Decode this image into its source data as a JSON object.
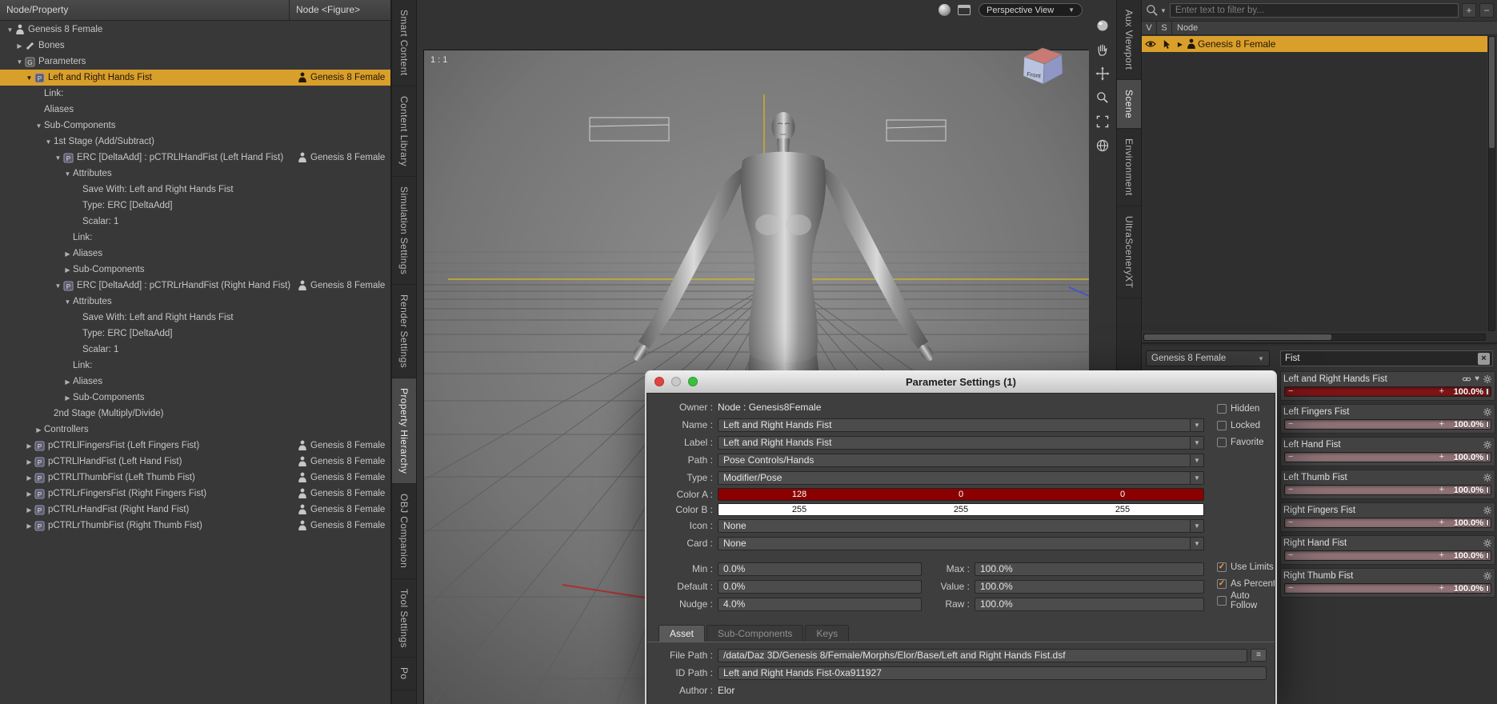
{
  "ui_colors": {
    "selection_highlight": "#d99f2b",
    "dialog_color_a_bg": "#8b0000",
    "dialog_color_a_fg": "#ffffff",
    "dialog_color_b_bg": "#ffffff",
    "dialog_color_b_fg": "#111111",
    "slider_fill_selected": "#7d1416",
    "slider_fill_default": "#8d7175"
  },
  "left_panel": {
    "header": {
      "label": "Node/Property",
      "column_label": "Node <Figure>"
    },
    "tree": [
      {
        "indent": 0,
        "arrow": "down",
        "icon": "figure",
        "label": "Genesis 8 Female"
      },
      {
        "indent": 1,
        "arrow": "right",
        "icon": "bone",
        "label": "Bones"
      },
      {
        "indent": 1,
        "arrow": "down",
        "icon": "group",
        "label": "Parameters"
      },
      {
        "indent": 2,
        "arrow": "down",
        "icon": "param",
        "label": "Left and Right Hands Fist",
        "right": "Genesis 8 Female",
        "selected": true
      },
      {
        "indent": 3,
        "label": "Link:"
      },
      {
        "indent": 3,
        "label": "Aliases"
      },
      {
        "indent": 3,
        "arrow": "down",
        "label": "Sub-Components"
      },
      {
        "indent": 4,
        "arrow": "down",
        "label": "1st Stage (Add/Subtract)"
      },
      {
        "indent": 5,
        "arrow": "down",
        "icon": "param",
        "label": "ERC [DeltaAdd] : pCTRLlHandFist (Left Hand Fist)",
        "right": "Genesis 8 Female"
      },
      {
        "indent": 6,
        "arrow": "down",
        "label": "Attributes"
      },
      {
        "indent": 7,
        "label": "Save With: Left and Right Hands Fist"
      },
      {
        "indent": 7,
        "label": "Type: ERC [DeltaAdd]"
      },
      {
        "indent": 7,
        "label": "Scalar: 1"
      },
      {
        "indent": 6,
        "label": "Link:"
      },
      {
        "indent": 6,
        "arrow": "right",
        "label": "Aliases"
      },
      {
        "indent": 6,
        "arrow": "right",
        "label": "Sub-Components"
      },
      {
        "indent": 5,
        "arrow": "down",
        "icon": "param",
        "label": "ERC [DeltaAdd] : pCTRLrHandFist (Right Hand Fist)",
        "right": "Genesis 8 Female"
      },
      {
        "indent": 6,
        "arrow": "down",
        "label": "Attributes"
      },
      {
        "indent": 7,
        "label": "Save With: Left and Right Hands Fist"
      },
      {
        "indent": 7,
        "label": "Type: ERC [DeltaAdd]"
      },
      {
        "indent": 7,
        "label": "Scalar: 1"
      },
      {
        "indent": 6,
        "label": "Link:"
      },
      {
        "indent": 6,
        "arrow": "right",
        "label": "Aliases"
      },
      {
        "indent": 6,
        "arrow": "right",
        "label": "Sub-Components"
      },
      {
        "indent": 4,
        "label": "2nd Stage (Multiply/Divide)"
      },
      {
        "indent": 3,
        "arrow": "right",
        "label": "Controllers"
      },
      {
        "indent": 2,
        "arrow": "right",
        "icon": "param",
        "label": "pCTRLlFingersFist (Left Fingers Fist)",
        "right": "Genesis 8 Female"
      },
      {
        "indent": 2,
        "arrow": "right",
        "icon": "param",
        "label": "pCTRLlHandFist (Left Hand Fist)",
        "right": "Genesis 8 Female"
      },
      {
        "indent": 2,
        "arrow": "right",
        "icon": "param",
        "label": "pCTRLlThumbFist (Left Thumb Fist)",
        "right": "Genesis 8 Female"
      },
      {
        "indent": 2,
        "arrow": "right",
        "icon": "param",
        "label": "pCTRLrFingersFist (Right Fingers Fist)",
        "right": "Genesis 8 Female"
      },
      {
        "indent": 2,
        "arrow": "right",
        "icon": "param",
        "label": "pCTRLrHandFist (Right Hand Fist)",
        "right": "Genesis 8 Female"
      },
      {
        "indent": 2,
        "arrow": "right",
        "icon": "param",
        "label": "pCTRLrThumbFist (Right Thumb Fist)",
        "right": "Genesis 8 Female"
      }
    ]
  },
  "left_tabs": {
    "items": [
      {
        "label": "Smart Content"
      },
      {
        "label": "Content Library"
      },
      {
        "label": "Simulation Settings"
      },
      {
        "label": "Render Settings"
      },
      {
        "label": "Property Hierarchy",
        "active": true
      },
      {
        "label": "OBJ Companion"
      },
      {
        "label": "Tool Settings"
      },
      {
        "label": "Po"
      }
    ]
  },
  "right_tabs": {
    "items": [
      {
        "label": "Aux Viewport"
      },
      {
        "label": "Scene",
        "active": true
      },
      {
        "label": "Environment"
      },
      {
        "label": "UltraSceneryXT"
      }
    ]
  },
  "viewport": {
    "aspect_label": "1 : 1",
    "camera_selector_label": "Perspective View",
    "cube_face_label": "Front",
    "tool_icons": [
      "sphere",
      "hand",
      "pan",
      "zoom",
      "frame",
      "globe"
    ]
  },
  "scene_panel": {
    "filter_placeholder": "Enter text to filter by...",
    "columns": {
      "visibility": "V",
      "selection": "S",
      "node": "Node"
    },
    "rows": [
      {
        "label": "Genesis 8 Female",
        "selected": true
      }
    ]
  },
  "parameters_panel": {
    "figure_selector": "Genesis 8 Female",
    "search_value": "Fist",
    "sliders": [
      {
        "label": "Left and Right Hands Fist",
        "value": "100.0%",
        "selected": true
      },
      {
        "label": "Left Fingers Fist",
        "value": "100.0%"
      },
      {
        "label": "Left Hand Fist",
        "value": "100.0%"
      },
      {
        "label": "Left Thumb Fist",
        "value": "100.0%"
      },
      {
        "label": "Right Fingers Fist",
        "value": "100.0%"
      },
      {
        "label": "Right Hand Fist",
        "value": "100.0%"
      },
      {
        "label": "Right Thumb Fist",
        "value": "100.0%"
      }
    ]
  },
  "dialog": {
    "title": "Parameter Settings (1)",
    "owner": {
      "label": "Owner :",
      "value": "Node : Genesis8Female"
    },
    "fields": [
      {
        "label": "Name :",
        "value": "Left and Right Hands Fist"
      },
      {
        "label": "Label :",
        "value": "Left and Right Hands Fist"
      },
      {
        "label": "Path :",
        "value": "Pose Controls/Hands"
      },
      {
        "label": "Type :",
        "value": "Modifier/Pose"
      }
    ],
    "color_a": {
      "label": "Color A :",
      "values": [
        "128",
        "0",
        "0"
      ]
    },
    "color_b": {
      "label": "Color B :",
      "values": [
        "255",
        "255",
        "255"
      ]
    },
    "icon_field": {
      "label": "Icon :",
      "value": "None"
    },
    "card_field": {
      "label": "Card :",
      "value": "None"
    },
    "limits": [
      {
        "label": "Min :",
        "value": "0.0%",
        "label2": "Max :",
        "value2": "100.0%"
      },
      {
        "label": "Default :",
        "value": "0.0%",
        "label2": "Value :",
        "value2": "100.0%"
      },
      {
        "label": "Nudge :",
        "value": "4.0%",
        "label2": "Raw :",
        "value2": "100.0%"
      }
    ],
    "flags_top": [
      {
        "label": "Hidden",
        "checked": false
      },
      {
        "label": "Locked",
        "checked": false
      },
      {
        "label": "Favorite",
        "checked": false
      }
    ],
    "flags_bottom": [
      {
        "label": "Use Limits",
        "checked": true
      },
      {
        "label": "As Percent",
        "checked": true
      },
      {
        "label": "Auto Follow",
        "checked": false
      }
    ],
    "tabs": [
      {
        "label": "Asset",
        "active": true
      },
      {
        "label": "Sub-Components",
        "active": false
      },
      {
        "label": "Keys",
        "active": false
      }
    ],
    "asset": {
      "file_path": {
        "label": "File Path :",
        "value": "/data/Daz 3D/Genesis 8/Female/Morphs/Elor/Base/Left and Right Hands Fist.dsf"
      },
      "id_path": {
        "label": "ID Path :",
        "value": "Left and Right Hands Fist-0xa911927"
      },
      "author": {
        "label": "Author :",
        "value": "Elor"
      }
    }
  }
}
